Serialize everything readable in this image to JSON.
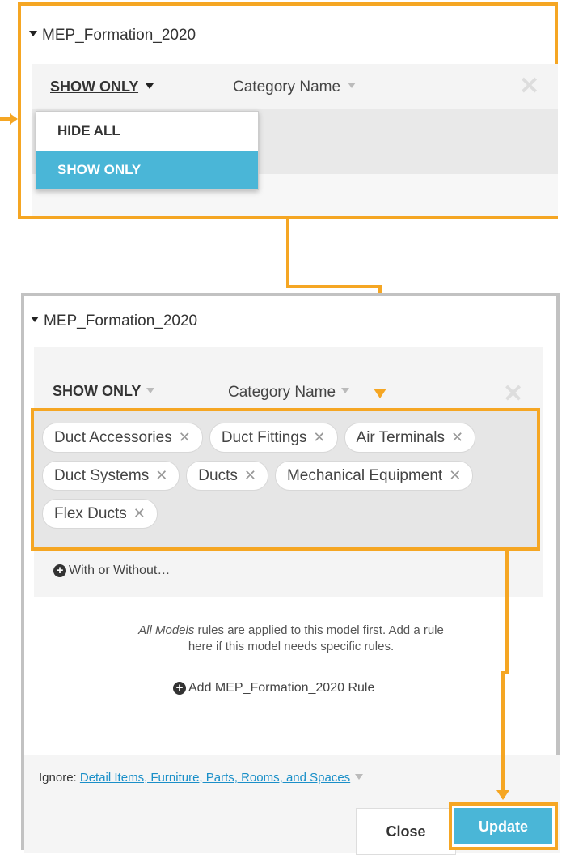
{
  "top_panel": {
    "model_name": "MEP_Formation_2020",
    "rule_mode": "SHOW ONLY",
    "category_label": "Category Name",
    "dropdown_options": [
      "HIDE ALL",
      "SHOW ONLY"
    ],
    "selected_option": "SHOW ONLY"
  },
  "bottom_panel": {
    "model_name": "MEP_Formation_2020",
    "rule_mode": "SHOW ONLY",
    "category_label": "Category Name",
    "chips": [
      "Duct Accessories",
      "Duct Fittings",
      "Air Terminals",
      "Duct Systems",
      "Ducts",
      "Mechanical Equipment",
      "Flex Ducts"
    ],
    "with_without_label": "With or Without…",
    "info_italic": "All Models",
    "info_line1_rest": " rules are applied to this model first. Add a rule",
    "info_line2": "here if this model needs specific rules.",
    "add_rule_label": "Add MEP_Formation_2020 Rule",
    "ignore_label": "Ignore:",
    "ignore_link": "Detail Items, Furniture, Parts, Rooms, and Spaces",
    "close_label": "Close",
    "update_label": "Update"
  },
  "colors": {
    "highlight": "#f5a623",
    "accent": "#4ab6d7",
    "link": "#1a8fc8"
  },
  "icons": [
    "caret-down-icon",
    "close-icon",
    "plus-circle-icon",
    "remove-chip-icon"
  ]
}
